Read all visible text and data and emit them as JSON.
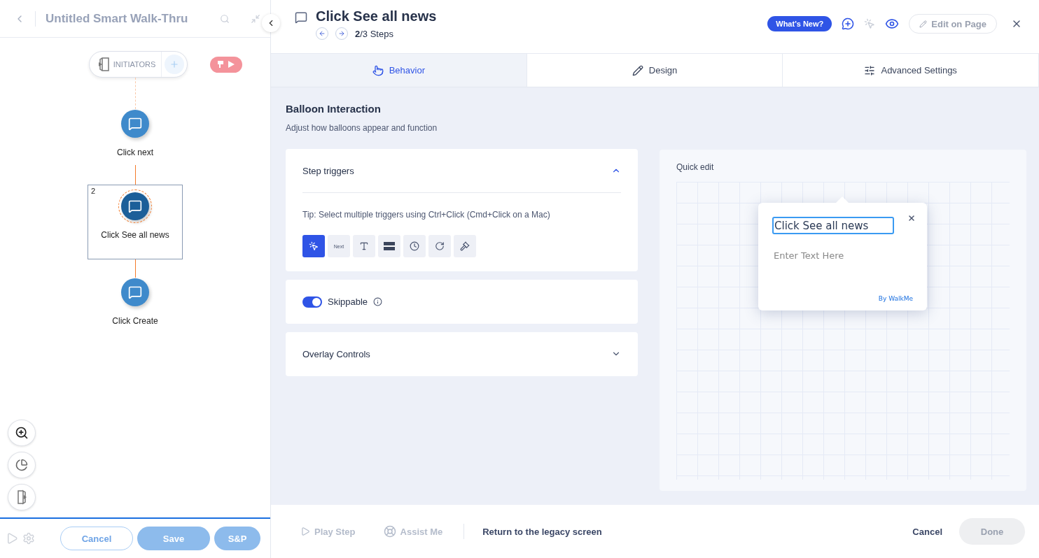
{
  "flow": {
    "title": "Untitled Smart Walk-Thru",
    "initiators": "INITIATORS",
    "steps": [
      {
        "label": "Click next",
        "selected": false
      },
      {
        "label": "Click See all news",
        "selected": true,
        "number": "2"
      },
      {
        "label": "Click Create",
        "selected": false
      }
    ]
  },
  "flow_footer": {
    "buttons": [
      {
        "label": "Cancel",
        "kind": "outline"
      },
      {
        "label": "Save",
        "kind": "filled"
      },
      {
        "label": "S&P",
        "kind": "filled"
      }
    ]
  },
  "header": {
    "title": "Click See all news",
    "steps": "**2**/3 Steps",
    "whats_new": "What's New?",
    "edit_on_page": "Edit on Page"
  },
  "tabs": [
    {
      "label": "Behavior",
      "kind": "behavior",
      "selected": true
    },
    {
      "label": "Design",
      "kind": "design",
      "selected": false
    },
    {
      "label": "Advanced Settings",
      "kind": "advanced",
      "selected": false
    }
  ],
  "section": {
    "title": "Balloon Interaction",
    "subtitle": "Adjust how balloons appear and function"
  },
  "step_triggers": {
    "title": "Step triggers",
    "expanded": true,
    "tip": "Tip: Select multiple triggers using Ctrl+Click (Cmd+Click on a Mac)",
    "triggers": [
      {
        "kind": "click",
        "selected": true
      },
      {
        "kind": "next",
        "label": "Next",
        "selected": false
      },
      {
        "kind": "text",
        "selected": false
      },
      {
        "kind": "banner",
        "selected": false
      },
      {
        "kind": "timer",
        "selected": false
      },
      {
        "kind": "refresh",
        "selected": false
      },
      {
        "kind": "gavel",
        "selected": false
      }
    ]
  },
  "skippable": {
    "label": "Skippable",
    "on": true
  },
  "overlay_controls": {
    "title": "Overlay Controls",
    "expanded": false
  },
  "quick_edit": {
    "title": "Quick edit",
    "balloon_title": "Click See all news",
    "body_placeholder": "Enter Text Here",
    "branding": "By WalkMe"
  },
  "footer": {
    "play_step": "Play Step",
    "assist_me": "Assist Me",
    "legacy": "Return to the legacy screen",
    "cancel": "Cancel",
    "done": "Done"
  }
}
